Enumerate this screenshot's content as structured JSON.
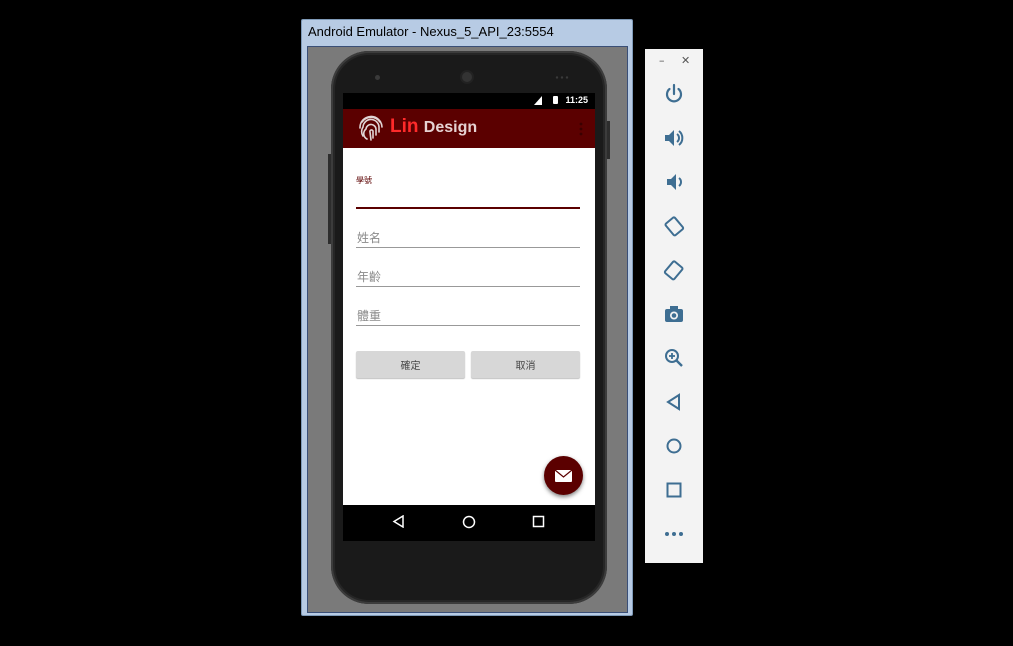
{
  "window": {
    "title": "Android Emulator - Nexus_5_API_23:5554"
  },
  "statusbar": {
    "time": "11:25"
  },
  "appbar": {
    "brand_lin": "Lin",
    "brand_design": "Design"
  },
  "form": {
    "student_id_label": "學號",
    "name_hint": "姓名",
    "age_hint": "年齡",
    "weight_hint": "體重",
    "confirm_label": "確定",
    "cancel_label": "取消"
  },
  "colors": {
    "primary": "#5b0000",
    "accent_red": "#ff2a2a"
  },
  "toolbar": {
    "minimize": "–",
    "close": "✕",
    "icons": [
      "power-icon",
      "volume-up-icon",
      "volume-down-icon",
      "rotate-left-icon",
      "rotate-right-icon",
      "camera-icon",
      "zoom-icon",
      "back-icon",
      "home-icon",
      "overview-icon",
      "more-icon"
    ]
  }
}
